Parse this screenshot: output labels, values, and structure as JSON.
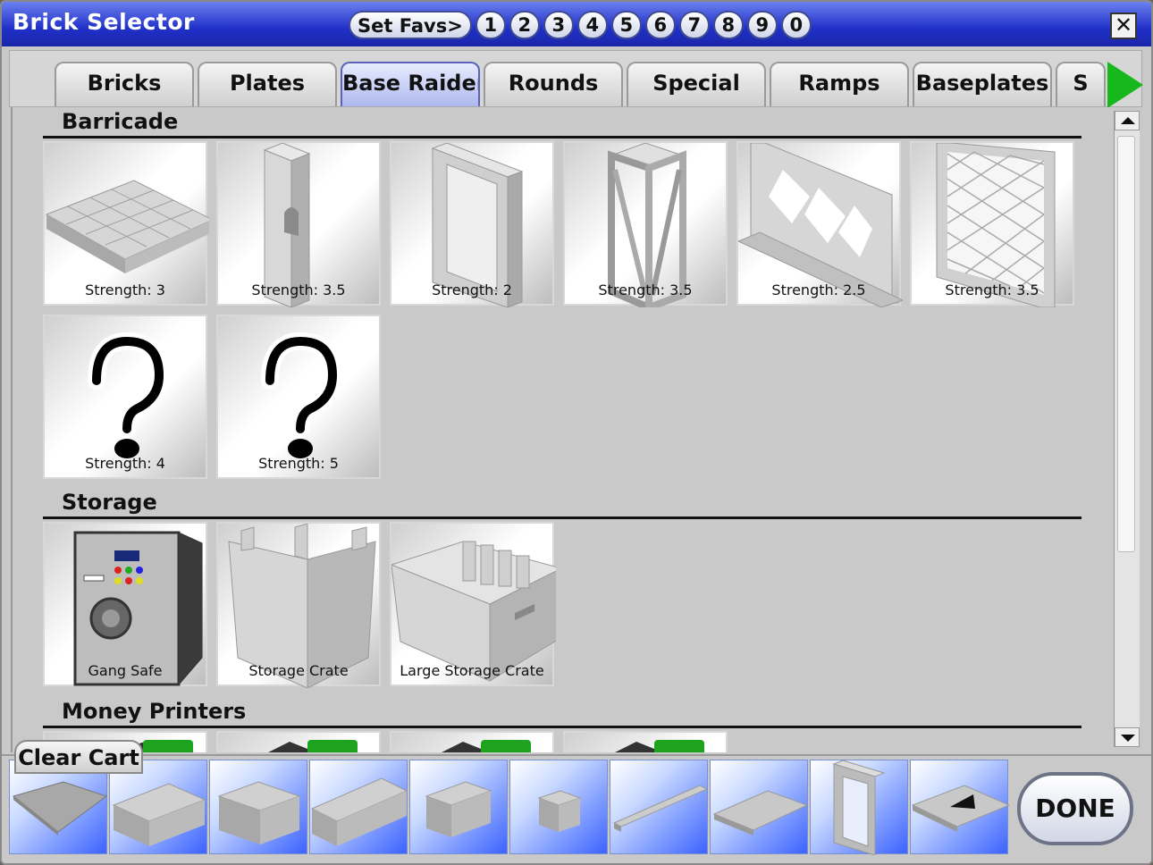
{
  "window": {
    "title": "Brick Selector",
    "close_label": "✕"
  },
  "favorites": {
    "label": "Set Favs>",
    "slots": [
      "1",
      "2",
      "3",
      "4",
      "5",
      "6",
      "7",
      "8",
      "9",
      "0"
    ]
  },
  "tabs": [
    {
      "label": "Bricks"
    },
    {
      "label": "Plates"
    },
    {
      "label": "Base Raiders",
      "active": true
    },
    {
      "label": "Rounds"
    },
    {
      "label": "Special"
    },
    {
      "label": "Ramps"
    },
    {
      "label": "Baseplates"
    },
    {
      "label": "S"
    }
  ],
  "sections": {
    "barricade": {
      "title": "Barricade",
      "items": [
        {
          "label": "Strength: 3",
          "icon": "flat-plate"
        },
        {
          "label": "Strength: 3.5",
          "icon": "arched-pillar"
        },
        {
          "label": "Strength: 2",
          "icon": "window-frame"
        },
        {
          "label": "Strength: 3.5",
          "icon": "x-frame"
        },
        {
          "label": "Strength: 2.5",
          "icon": "lattice-fence"
        },
        {
          "label": "Strength: 3.5",
          "icon": "grid-fence"
        },
        {
          "label": "Strength: 4",
          "icon": "question-mark"
        },
        {
          "label": "Strength: 5",
          "icon": "question-mark"
        }
      ]
    },
    "storage": {
      "title": "Storage",
      "items": [
        {
          "label": "Gang Safe",
          "icon": "safe"
        },
        {
          "label": "Storage Crate",
          "icon": "crate"
        },
        {
          "label": "Large Storage Crate",
          "icon": "large-crate"
        }
      ]
    },
    "money_printers": {
      "title": "Money Printers"
    }
  },
  "cart": {
    "clear_label": "Clear Cart",
    "done_label": "DONE",
    "slots": [
      "baseplate",
      "brick-2x4",
      "brick-2x2",
      "brick-2x6",
      "brick-1x2",
      "brick-1x1",
      "beam-long",
      "plate-large",
      "window-frame",
      "ramp-plate"
    ]
  },
  "colors": {
    "title_blue": "#2030c8",
    "tab_active": "#aeb9ee",
    "arrow_green": "#17b81c",
    "cart_blue": "#3b63ff"
  }
}
